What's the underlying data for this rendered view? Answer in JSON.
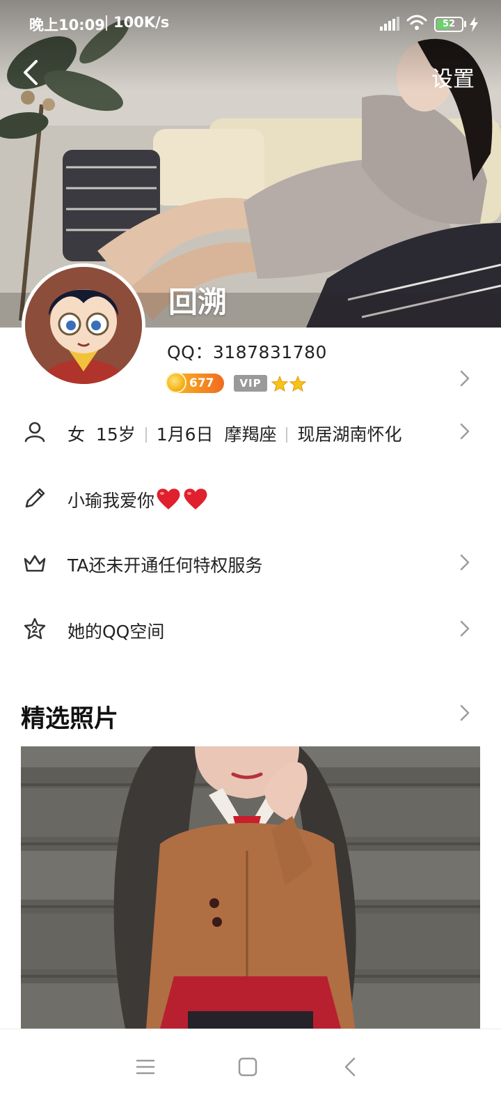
{
  "status_bar": {
    "time": "晚上10:09",
    "network_speed": "100K/s",
    "battery_level": "52",
    "battery_fraction": 0.52,
    "icons": [
      "signal-icon",
      "wifi-icon",
      "battery-icon",
      "charging-bolt-icon"
    ]
  },
  "nav": {
    "back_icon": "chevron-left-icon",
    "settings_label": "设置"
  },
  "profile": {
    "nickname": "回溯",
    "qq_line": "QQ：3187831780",
    "coin_level": "677",
    "vip_label": "VIP",
    "star_count": 2
  },
  "info_rows": {
    "basic": {
      "gender": "女",
      "age": "15岁",
      "birthday": "1月6日",
      "zodiac": "摩羯座",
      "location": "现居湖南怀化",
      "icon": "person-icon"
    },
    "signature": {
      "text": "小瑜我爱你",
      "icon": "pencil-icon",
      "emoji": "red-hearts"
    },
    "privilege": {
      "text": "TA还未开通任何特权服务",
      "icon": "crown-icon"
    },
    "qzone": {
      "text": "她的QQ空间",
      "icon": "star-badge-icon"
    }
  },
  "photos_section": {
    "title": "精选照片"
  },
  "bottom_nav": {
    "icons": [
      "menu-icon",
      "home-square-icon",
      "back-triangle-icon"
    ]
  },
  "colors": {
    "accent_coin": "#f5a623",
    "vip_gray": "#9a9a9a",
    "star_gold": "#f7c21c",
    "heart_red": "#e0202e",
    "text_primary": "#222222",
    "chevron_gray": "#9c9c9c"
  }
}
